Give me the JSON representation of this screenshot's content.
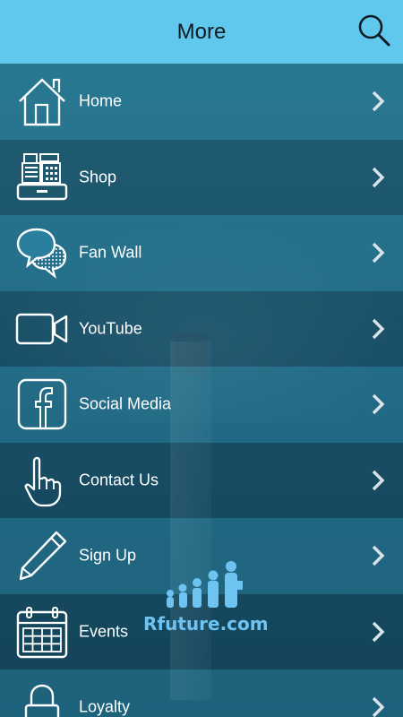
{
  "header": {
    "title": "More",
    "search_icon": "search-icon",
    "bg_color": "#5fc8ec"
  },
  "menu": {
    "items": [
      {
        "label": "Home",
        "icon": "home-icon"
      },
      {
        "label": "Shop",
        "icon": "cash-register-icon"
      },
      {
        "label": "Fan Wall",
        "icon": "chat-bubbles-icon"
      },
      {
        "label": "YouTube",
        "icon": "video-camera-icon"
      },
      {
        "label": "Social Media",
        "icon": "facebook-icon"
      },
      {
        "label": "Contact Us",
        "icon": "pointing-hand-icon"
      },
      {
        "label": "Sign Up",
        "icon": "pencil-icon"
      },
      {
        "label": "Events",
        "icon": "calendar-icon"
      },
      {
        "label": "Loyalty",
        "icon": "lock-icon"
      }
    ],
    "chevron_icon": "chevron-right-icon"
  },
  "watermark": {
    "text": "Rfuture.com",
    "color": "#6ec3f0"
  }
}
